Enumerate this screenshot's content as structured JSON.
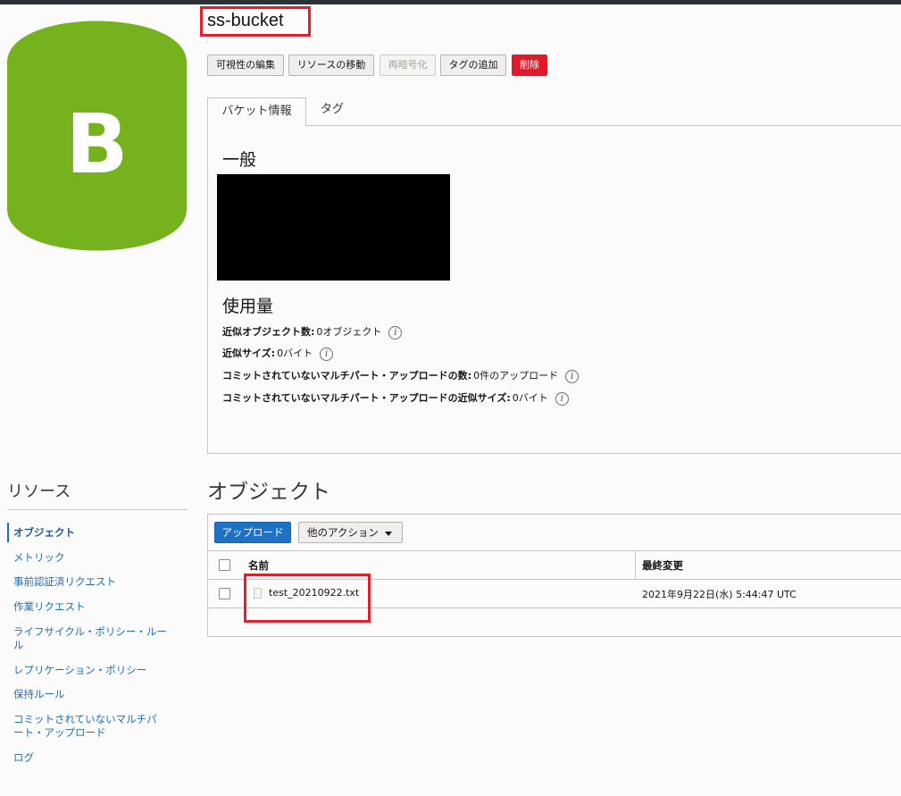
{
  "bucket": {
    "icon_letter": "B",
    "icon_color": "#76b11e",
    "name": "ss-bucket"
  },
  "actions": {
    "edit_visibility": "可視性の編集",
    "move_resource": "リソースの移動",
    "re_encrypt": "再暗号化",
    "add_tags": "タグの追加",
    "delete": "削除"
  },
  "tabs": {
    "bucket_info": "バケット情報",
    "tags": "タグ"
  },
  "general": {
    "heading": "一般"
  },
  "usage": {
    "heading": "使用量",
    "rows": [
      {
        "label": "近似オブジェクト数:",
        "value": "0オブジェクト"
      },
      {
        "label": "近似サイズ:",
        "value": "0バイト"
      },
      {
        "label": "コミットされていないマルチパート・アップロードの数:",
        "value": "0件のアップロード"
      },
      {
        "label": "コミットされていないマルチパート・アップロードの近似サイズ:",
        "value": "0バイト"
      }
    ]
  },
  "resources": {
    "heading": "リソース",
    "items": [
      {
        "label": "オブジェクト",
        "active": true
      },
      {
        "label": "メトリック"
      },
      {
        "label": "事前認証済リクエスト"
      },
      {
        "label": "作業リクエスト"
      },
      {
        "label": "ライフサイクル・ポリシー・ルール"
      },
      {
        "label": "レプリケーション・ポリシー"
      },
      {
        "label": "保持ルール"
      },
      {
        "label": "コミットされていないマルチパート・アップロード"
      },
      {
        "label": "ログ"
      }
    ]
  },
  "objects": {
    "heading": "オブジェクト",
    "upload_label": "アップロード",
    "more_actions_label": "他のアクション",
    "columns": {
      "name": "名前",
      "modified": "最終変更"
    },
    "rows": [
      {
        "name": "test_20210922.txt",
        "modified": "2021年9月22日(水) 5:44:47 UTC"
      }
    ]
  },
  "colors": {
    "accent": "#1f72c3",
    "danger": "#e01a2b",
    "highlight_box": "#e0202e"
  }
}
